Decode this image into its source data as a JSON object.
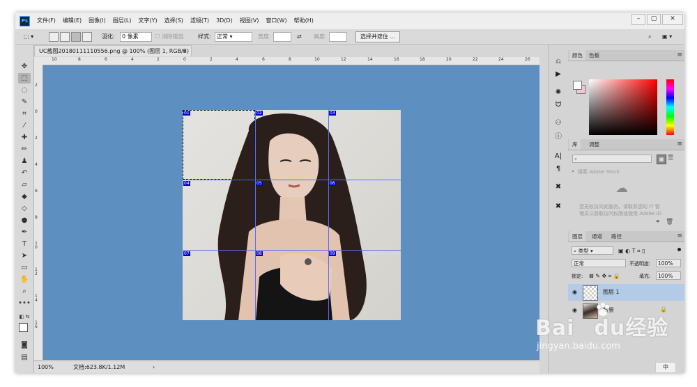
{
  "app": {
    "logo": "Ps",
    "menus": [
      "文件(F)",
      "编辑(E)",
      "图像(I)",
      "图层(L)",
      "文字(Y)",
      "选择(S)",
      "滤镜(T)",
      "3D(D)",
      "视图(V)",
      "窗口(W)",
      "帮助(H)"
    ],
    "window_controls": [
      "minimize-icon",
      "maximize-icon",
      "close-icon"
    ]
  },
  "options": {
    "feather_label": "羽化:",
    "feather_value": "0 像素",
    "antialias_label": "消除锯齿",
    "style_label": "样式:",
    "style_value": "正常",
    "width_label": "宽度:",
    "height_label": "高度:",
    "select_mask_button": "选择并遮住 ..."
  },
  "document": {
    "tab_title": "UC截图20180111110556.png @ 100% (图层 1, RGB/8) *",
    "tab_close": "×",
    "zoom": "100%",
    "doc_info": "文档:623.8K/1.12M",
    "status_arrow": "›",
    "canvas_bg": "#5d8fc0"
  },
  "rulers": {
    "top": [
      "10",
      "8",
      "6",
      "4",
      "2",
      "0",
      "2",
      "4",
      "6",
      "8",
      "10",
      "12",
      "14",
      "16",
      "18",
      "20",
      "22",
      "24",
      "26"
    ],
    "left": [
      "2",
      "0",
      "2",
      "4",
      "6",
      "8",
      "1\n0",
      "1\n2",
      "1\n4",
      "1\n6"
    ]
  },
  "slices": [
    "01",
    "02",
    "03",
    "04",
    "05",
    "06",
    "07",
    "08",
    "09"
  ],
  "panels": {
    "color_tabs": [
      "颜色",
      "色板"
    ],
    "library_tabs": [
      "库",
      "调整"
    ],
    "library_search": "搜索 Adobe Stock",
    "library_message_1": "您无权访问此服务。请联系您的 IT 管",
    "library_message_2": "理员以获取访问权限或使用 Adobe ID",
    "layers_tabs": [
      "图层",
      "通道",
      "路径"
    ],
    "filter_kind": "类型",
    "blend_mode": "正常",
    "opacity_label": "不透明度:",
    "opacity_value": "100%",
    "lock_label": "锁定:",
    "fill_label": "填充:",
    "fill_value": "100%",
    "layers": [
      {
        "name": "图层 1",
        "selected": true
      },
      {
        "name": "背景",
        "selected": false
      }
    ],
    "foreground_color": "#ffffff",
    "background_color": "#f4c6cc"
  },
  "watermark": {
    "brand": "Bai",
    "brand_tail": "du",
    "cn": "经验",
    "url": "jingyan.baidu.com"
  },
  "taskbar_tray": "中"
}
